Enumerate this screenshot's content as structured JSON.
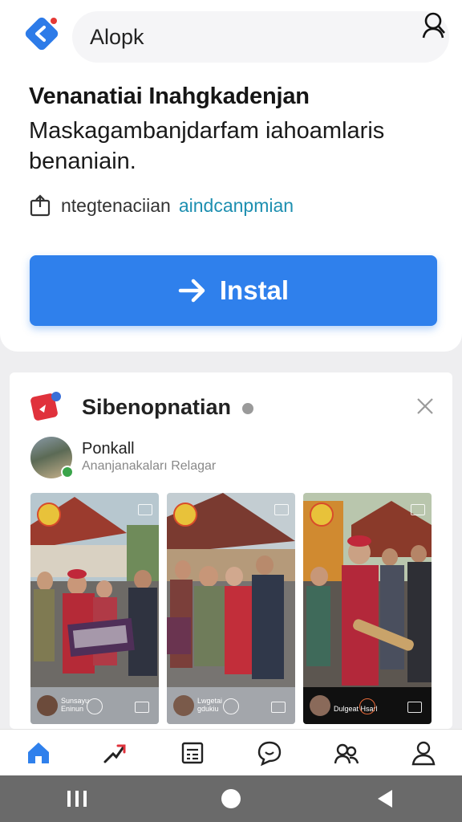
{
  "header": {
    "search_text": "Alopk"
  },
  "listing": {
    "headline": "Venanatiai Inahgkadenjan",
    "description": "Maskagambanjdarfam iahoamlaris benaniain.",
    "meta_text": "ntegtenaciian",
    "meta_link": "aindcanpmian",
    "install_label": "Instal"
  },
  "post": {
    "channel_title": "Sibenopnatian",
    "poster_name": "Ponkall",
    "poster_subtitle": "Ananjanakaları Relagar",
    "thumbnails": [
      {
        "caption": "Sunsayu Eninun"
      },
      {
        "caption": "Lwgetai gdukiu"
      },
      {
        "caption": "Dulgeat Hsarl"
      }
    ]
  },
  "nav": {
    "items": [
      "home-icon",
      "trending-icon",
      "list-icon",
      "chat-icon",
      "community-icon",
      "profile-icon"
    ]
  },
  "colors": {
    "accent": "#2f80ec",
    "link": "#1d8fb0",
    "system_bar": "#6a6a6a"
  }
}
